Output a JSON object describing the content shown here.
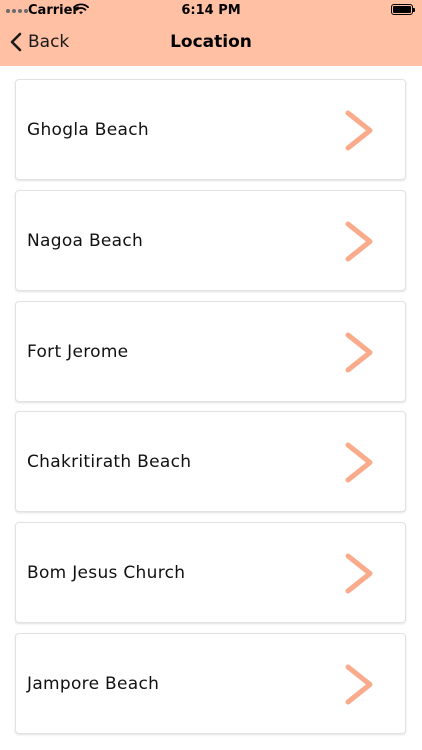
{
  "status_bar": {
    "carrier": "Carrier",
    "time": "6:14 PM",
    "battery_level": 1.0
  },
  "nav": {
    "back_label": "Back",
    "title": "Location"
  },
  "theme": {
    "header_bg": "#ffc0a3",
    "chevron_color": "#f9ab8b"
  },
  "locations": [
    {
      "name": "Ghogla Beach"
    },
    {
      "name": "Nagoa Beach"
    },
    {
      "name": "Fort Jerome"
    },
    {
      "name": "Chakritirath Beach"
    },
    {
      "name": "Bom Jesus Church"
    },
    {
      "name": "Jampore Beach"
    }
  ]
}
